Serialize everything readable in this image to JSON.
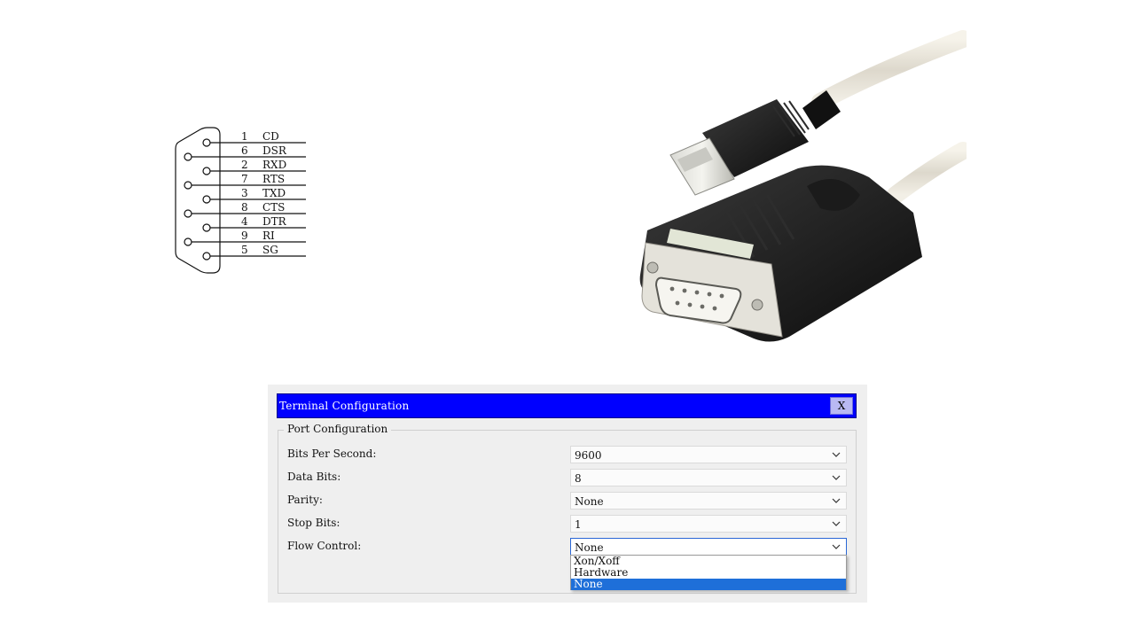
{
  "pinout": {
    "pins": [
      {
        "num": "1",
        "name": "CD"
      },
      {
        "num": "6",
        "name": "DSR"
      },
      {
        "num": "2",
        "name": "RXD"
      },
      {
        "num": "7",
        "name": "RTS"
      },
      {
        "num": "3",
        "name": "TXD"
      },
      {
        "num": "8",
        "name": "CTS"
      },
      {
        "num": "4",
        "name": "DTR"
      },
      {
        "num": "9",
        "name": "RI"
      },
      {
        "num": "5",
        "name": "SG"
      }
    ]
  },
  "dialog": {
    "title": "Terminal Configuration",
    "close_label": "X",
    "group_label": "Port Configuration",
    "fields": [
      {
        "label": "Bits Per Second:",
        "value": "9600"
      },
      {
        "label": "Data Bits:",
        "value": "8"
      },
      {
        "label": "Parity:",
        "value": "None"
      },
      {
        "label": "Stop Bits:",
        "value": "1"
      },
      {
        "label": "Flow Control:",
        "value": "None"
      }
    ],
    "flow_control_options": [
      "Xon/Xoff",
      "Hardware",
      "None"
    ],
    "flow_control_selected": "None",
    "colors": {
      "titlebar": "#0000ff",
      "selection": "#1e6fd9"
    }
  }
}
